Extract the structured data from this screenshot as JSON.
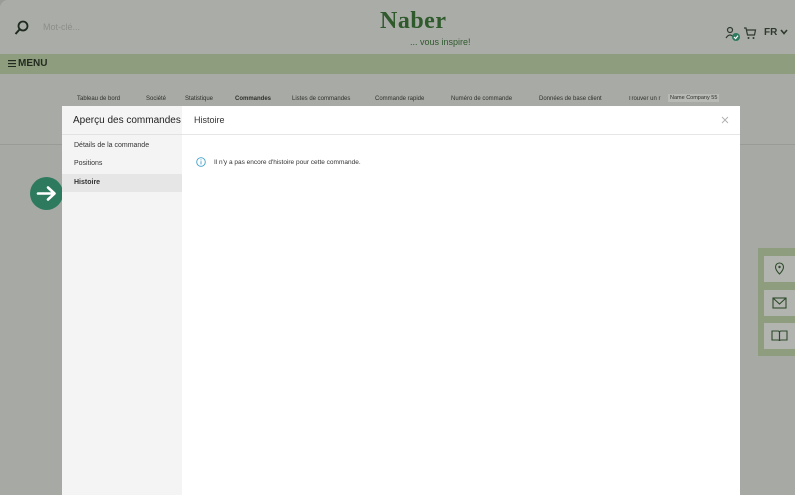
{
  "search": {
    "placeholder": "Mot-clé..."
  },
  "brand": {
    "name": "Naber",
    "tagline": "... vous inspire!"
  },
  "header": {
    "language": "FR"
  },
  "menu": {
    "label": "MENU"
  },
  "nav": {
    "items": [
      "Tableau de bord",
      "Société",
      "Statistique",
      "Commandes",
      "Listes de commandes",
      "Commande rapide",
      "Numéro de commande",
      "Données de base client",
      "Trouver un r"
    ],
    "active": "Commandes",
    "company": "Name Company 55"
  },
  "modal": {
    "side_title": "Aperçu des commandes",
    "side_items": [
      "Détails de la commande",
      "Positions",
      "Histoire"
    ],
    "active_item": "Histoire",
    "header_title": "Histoire",
    "info_text": "Il n'y a pas encore d'histoire pour cette commande."
  },
  "floating": {
    "icons": [
      "location-icon",
      "mail-icon",
      "book-icon"
    ]
  },
  "colors": {
    "accent": "#2e7a5e",
    "brand": "#2f5a2c",
    "menu_bar": "#8e9d7e",
    "info": "#3fa0c8"
  }
}
